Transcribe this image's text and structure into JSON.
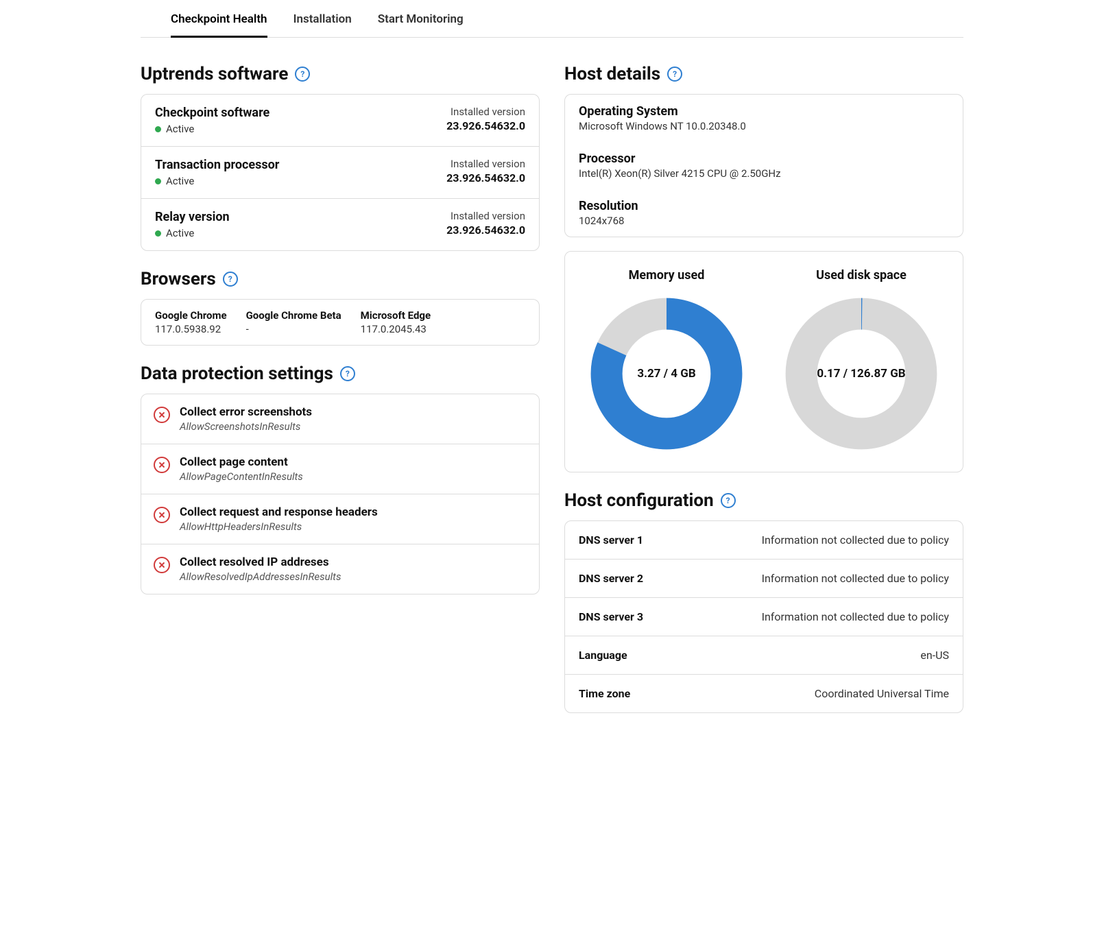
{
  "tabs": {
    "0": {
      "label": "Checkpoint Health"
    },
    "1": {
      "label": "Installation"
    },
    "2": {
      "label": "Start Monitoring"
    },
    "active": 0
  },
  "left": {
    "uptrends": {
      "heading": "Uptrends software",
      "items": [
        {
          "name": "Checkpoint software",
          "status": "Active",
          "version_label": "Installed version",
          "version": "23.926.54632.0"
        },
        {
          "name": "Transaction processor",
          "status": "Active",
          "version_label": "Installed version",
          "version": "23.926.54632.0"
        },
        {
          "name": "Relay version",
          "status": "Active",
          "version_label": "Installed version",
          "version": "23.926.54632.0"
        }
      ]
    },
    "browsers": {
      "heading": "Browsers",
      "items": [
        {
          "name": "Google Chrome",
          "version": "117.0.5938.92"
        },
        {
          "name": "Google Chrome Beta",
          "version": "-"
        },
        {
          "name": "Microsoft Edge",
          "version": "117.0.2045.43"
        }
      ]
    },
    "dp": {
      "heading": "Data protection settings",
      "items": [
        {
          "title": "Collect error screenshots",
          "key": "AllowScreenshotsInResults"
        },
        {
          "title": "Collect page content",
          "key": "AllowPageContentInResults"
        },
        {
          "title": "Collect request and response headers",
          "key": "AllowHttpHeadersInResults"
        },
        {
          "title": "Collect resolved IP addreses",
          "key": "AllowResolvedIpAddressesInResults"
        }
      ]
    }
  },
  "right": {
    "host_details": {
      "heading": "Host details",
      "os_label": "Operating System",
      "os_value": "Microsoft Windows NT 10.0.20348.0",
      "cpu_label": "Processor",
      "cpu_value": "Intel(R) Xeon(R) Silver 4215 CPU @ 2.50GHz",
      "res_label": "Resolution",
      "res_value": "1024x768"
    },
    "gauges": {
      "memory": {
        "title": "Memory used",
        "label": "3.27 / 4 GB",
        "fraction": 0.8175
      },
      "disk": {
        "title": "Used disk space",
        "label": "0.17 / 126.87 GB",
        "fraction": 0.00134
      }
    },
    "host_config": {
      "heading": "Host configuration",
      "rows": [
        {
          "k": "DNS server 1",
          "v": "Information not collected due to policy"
        },
        {
          "k": "DNS server 2",
          "v": "Information not collected due to policy"
        },
        {
          "k": "DNS server 3",
          "v": "Information not collected due to policy"
        },
        {
          "k": "Language",
          "v": "en-US"
        },
        {
          "k": "Time zone",
          "v": "Coordinated Universal Time"
        }
      ]
    }
  },
  "chart_data": [
    {
      "type": "pie",
      "title": "Memory used",
      "series": [
        {
          "name": "used",
          "values": [
            3.27
          ]
        },
        {
          "name": "total",
          "values": [
            4
          ]
        }
      ],
      "unit": "GB"
    },
    {
      "type": "pie",
      "title": "Used disk space",
      "series": [
        {
          "name": "used",
          "values": [
            0.17
          ]
        },
        {
          "name": "total",
          "values": [
            126.87
          ]
        }
      ],
      "unit": "GB"
    }
  ]
}
